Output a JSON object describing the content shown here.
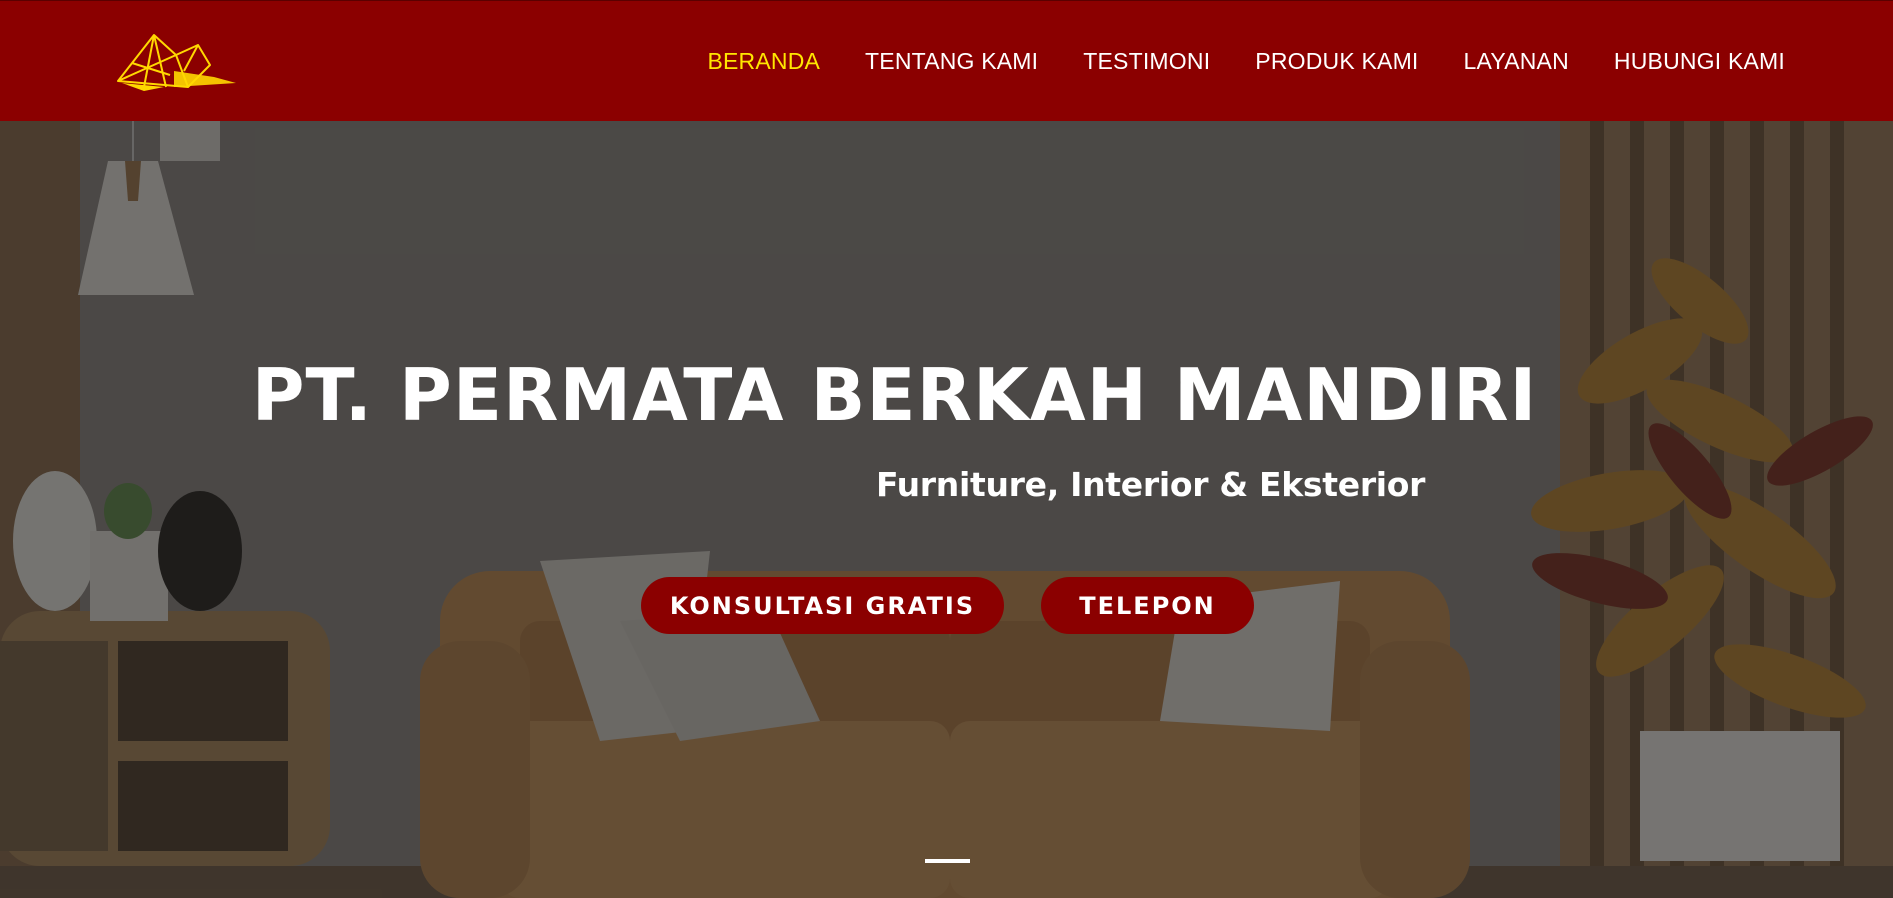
{
  "nav": {
    "items": [
      {
        "label": "BERANDA",
        "active": true
      },
      {
        "label": "TENTANG KAMI",
        "active": false
      },
      {
        "label": "TESTIMONI",
        "active": false
      },
      {
        "label": "PRODUK KAMI",
        "active": false
      },
      {
        "label": "LAYANAN",
        "active": false
      },
      {
        "label": "HUBUNGI KAMI",
        "active": false
      }
    ]
  },
  "hero": {
    "title": "PT. PERMATA BERKAH MANDIRI",
    "subtitle": "Furniture, Interior & Eksterior",
    "primary_button": "KONSULTASI GRATIS",
    "secondary_button": "TELEPON",
    "slide_indicator": {
      "current": 1
    }
  },
  "colors": {
    "header_bg": "#8b0000",
    "active_nav": "#ffe600",
    "button_bg": "#8b0000",
    "text": "#ffffff",
    "logo": "#ffd800"
  },
  "icons": {
    "logo": "diamond-logo-icon"
  }
}
